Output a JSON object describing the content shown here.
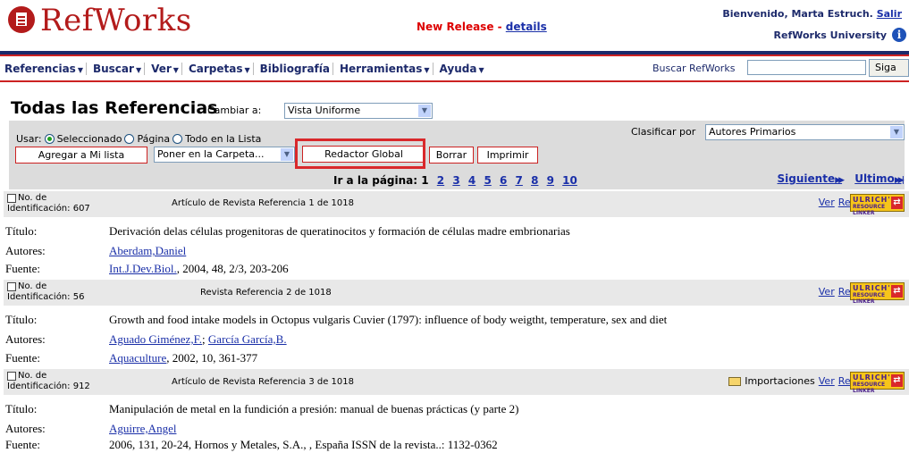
{
  "header": {
    "logo_text": "RefWorks",
    "new_release": "New Release - ",
    "details_link": "details",
    "welcome": "Bienvenido, Marta Estruch. ",
    "logout_link": "Salir",
    "university": "RefWorks University"
  },
  "menu": {
    "items": [
      "Referencias",
      "Buscar",
      "Ver",
      "Carpetas",
      "Bibliografía",
      "Herramientas",
      "Ayuda"
    ],
    "search_label": "Buscar RefWorks",
    "search_value": "",
    "search_button": "Siga"
  },
  "page": {
    "title": "Todas las Referencias",
    "change_label": "Cambiar a:",
    "view_value": "Vista Uniforme"
  },
  "toolbar": {
    "use_label": "Usar:",
    "use_options": [
      "Seleccionado",
      "Página",
      "Todo en la Lista"
    ],
    "use_selected": "Seleccionado",
    "add_button": "Agregar a Mi lista",
    "folder_select": "Poner en la Carpeta...",
    "global_button": "Redactor Global",
    "delete_button": "Borrar",
    "print_button": "Imprimir",
    "sort_label": "Clasificar  por",
    "sort_value": "Autores Primarios",
    "goto_label": "Ir a la página:",
    "current_page": "1",
    "pages": [
      "2",
      "3",
      "4",
      "5",
      "6",
      "7",
      "8",
      "9",
      "10"
    ],
    "next_link": "Siguiente",
    "last_link": "Ultimo"
  },
  "record_labels": {
    "id_prefix": "No. de",
    "id_label": "Identificación:",
    "view_link": "Ver",
    "edit_link": "Redactar",
    "ulrich_top": "ULRICH'S",
    "ulrich_bottom": "RESOURCE LINKER",
    "title_label": "Título:",
    "authors_label": "Autores:",
    "source_label": "Fuente:"
  },
  "records": [
    {
      "id": "607",
      "type": "Artículo de Revista Referencia 1 de 1018",
      "folder": "",
      "title": "Derivación delas células progenitoras de queratinocitos y formación de células madre embrionarias",
      "authors": [
        "Aberdam,Daniel"
      ],
      "source_link": "Int.J.Dev.Biol.",
      "source_rest": ", 2004, 48, 2/3, 203-206"
    },
    {
      "id": "56",
      "type": "Revista Referencia 2 de 1018",
      "folder": "",
      "title": "Growth and food intake models in Octopus vulgaris Cuvier (1797): influence of body weigtht, temperature, sex and diet",
      "authors": [
        "Aguado Giménez,F.",
        "García García,B."
      ],
      "source_link": "Aquaculture",
      "source_rest": ", 2002, 10, 361-377"
    },
    {
      "id": "912",
      "type": "Artículo de Revista Referencia 3 de 1018",
      "folder": "Importaciones",
      "title": "Manipulación de metal en la fundición a presión: manual de buenas prácticas (y parte 2)",
      "authors": [
        "Aguirre,Angel"
      ],
      "source_link": "",
      "source_rest": "2006, 131, 20-24, Hornos y Metales, S.A., , España ISSN de la revista..: 1132-0362"
    }
  ]
}
